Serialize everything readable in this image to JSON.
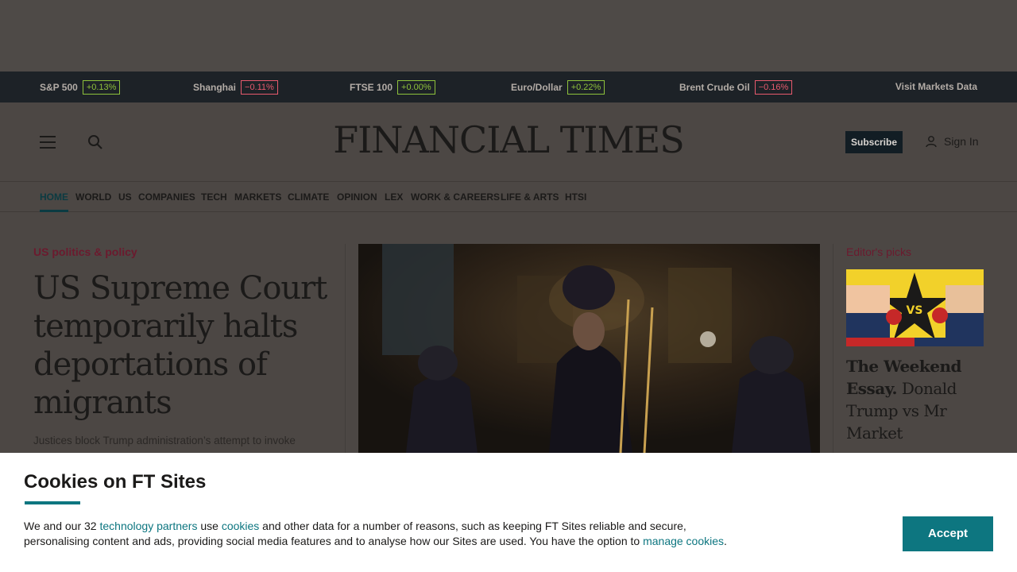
{
  "ticker": {
    "items": [
      {
        "name": "S&P 500",
        "change": "+0.13%",
        "direction": "up"
      },
      {
        "name": "Shanghai",
        "change": "−0.11%",
        "direction": "down"
      },
      {
        "name": "FTSE 100",
        "change": "+0.00%",
        "direction": "up"
      },
      {
        "name": "Euro/Dollar",
        "change": "+0.22%",
        "direction": "up"
      },
      {
        "name": "Brent Crude Oil",
        "change": "−0.16%",
        "direction": "down"
      }
    ],
    "visit_label": "Visit Markets Data"
  },
  "header": {
    "logo": "FINANCIAL TIMES",
    "subscribe_label": "Subscribe",
    "signin_label": "Sign In",
    "icons": {
      "menu": "hamburger-menu-icon",
      "search": "search-icon",
      "user": "user-icon"
    }
  },
  "nav": {
    "items": [
      "HOME",
      "WORLD",
      "US",
      "COMPANIES",
      "TECH",
      "MARKETS",
      "CLIMATE",
      "OPINION",
      "LEX",
      "WORK & CAREERS",
      "LIFE & ARTS",
      "HTSI"
    ],
    "active": "HOME"
  },
  "lead_story": {
    "topic": "US politics & policy",
    "headline": "US Supreme Court temporarily halts deportations of migrants",
    "standfirst": "Justices block Trump administration’s attempt to invoke"
  },
  "editors_picks": {
    "label": "Editor's picks",
    "headline_bold": "The Weekend Essay.",
    "headline_rest": " Donald Trump vs Mr Market",
    "image_text": "VS"
  },
  "cookie_banner": {
    "title": "Cookies on FT Sites",
    "text_1": "We and our 32 ",
    "link_partners": "technology partners",
    "text_2": " use ",
    "link_cookies": "cookies",
    "text_3": " and other data for a number of reasons, such as keeping FT Sites reliable and secure, personalising content and ads, providing social media features and to analyse how our Sites are used. You have the option to ",
    "link_manage": "manage cookies",
    "text_4": ".",
    "accept_label": "Accept"
  },
  "colors": {
    "accent_teal": "#0d7680",
    "ticker_up": "#8ec23b",
    "ticker_down": "#e85a6d",
    "topic_claret": "#6b1a2e"
  }
}
